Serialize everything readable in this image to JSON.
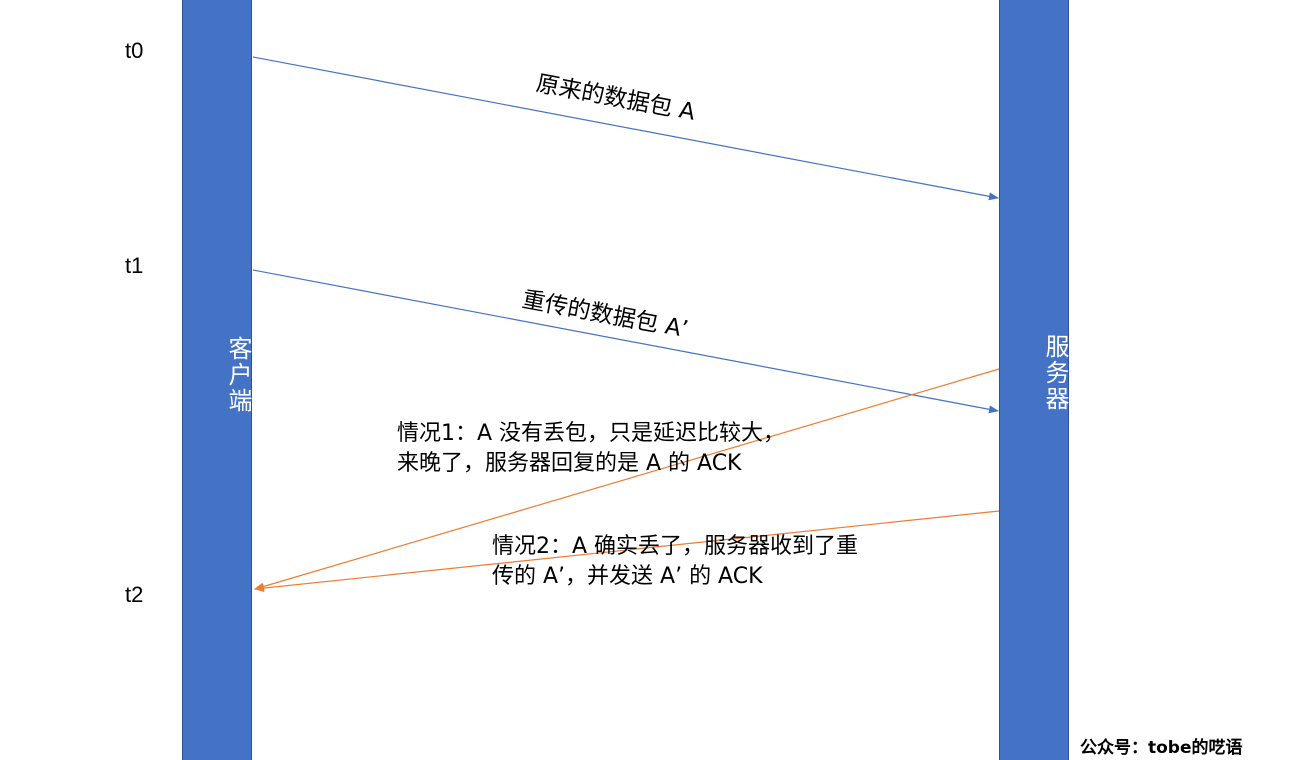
{
  "timeline": {
    "client_label": "客户端",
    "server_label": "服务器",
    "times": [
      "t0",
      "t1",
      "t2"
    ]
  },
  "messages": {
    "original_packet": "原来的数据包 A",
    "retransmitted_packet": "重传的数据包 A’"
  },
  "notes": {
    "case1": "情况1：A 没有丢包，只是延迟比较大，\n来晚了，服务器回复的是 A 的 ACK",
    "case2": "情况2：A 确实丢了，服务器收到了重\n传的 A’，并发送 A’ 的 ACK"
  },
  "colors": {
    "bar": "#4472C4",
    "request_arrow": "#4472C4",
    "ack_arrow": "#ED7D31"
  },
  "watermark": "公众号：tobe的呓语"
}
